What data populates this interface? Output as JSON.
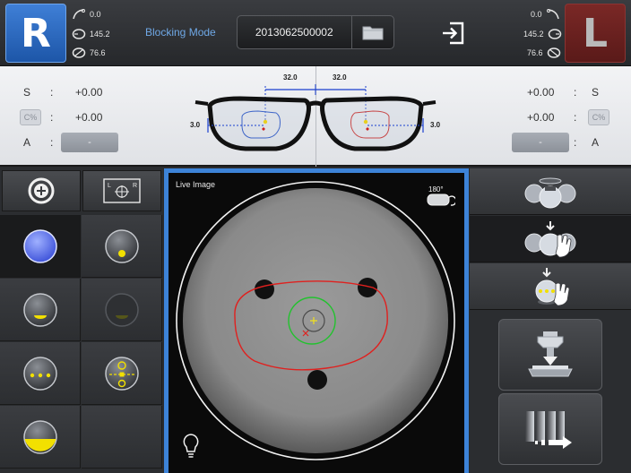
{
  "header": {
    "right_eye_label": "R",
    "left_eye_label": "L",
    "right_measures": [
      "0.0",
      "145.2",
      "76.6"
    ],
    "left_measures": [
      "0.0",
      "145.2",
      "76.6"
    ],
    "mode": "Blocking Mode",
    "job_id": "2013062500002"
  },
  "lens_info": {
    "row_labels": [
      "S",
      "C",
      "A"
    ],
    "separator": ":",
    "right": {
      "sphere": "+0.00",
      "cylinder": "+0.00",
      "axis": "-"
    },
    "left": {
      "sphere": "+0.00",
      "cylinder": "+0.00",
      "axis": "-"
    },
    "cyl_icon_text": "C%",
    "dimensions": {
      "pd_right": "32.0",
      "pd_left": "32.0",
      "height_right": "3.0",
      "height_left": "3.0"
    }
  },
  "live_image": {
    "title": "Live Image",
    "rotate_label": "180°"
  },
  "colors": {
    "accent_blue": "#3d83d8",
    "right_eye": "#2f6fc9",
    "left_eye": "#7a2826",
    "marking": "#e0201e",
    "target": "#22c22e",
    "center_mark": "#f0e020"
  }
}
